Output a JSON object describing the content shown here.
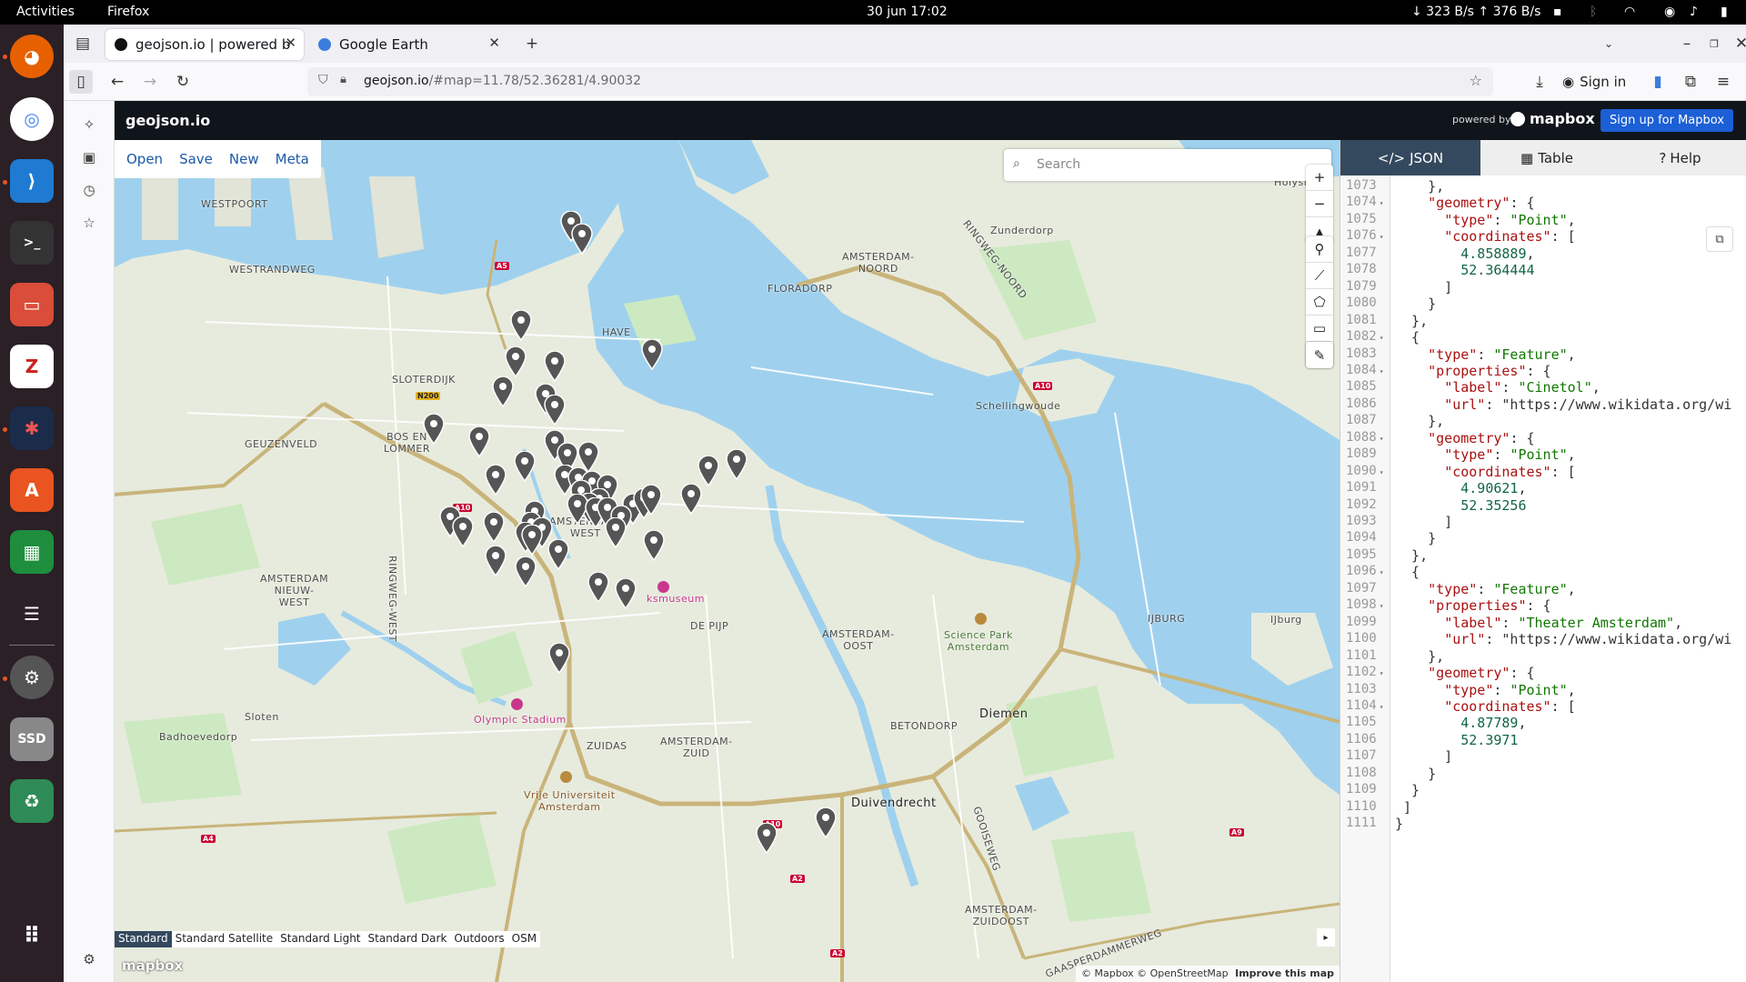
{
  "system": {
    "activities": "Activities",
    "app_name": "Firefox",
    "datetime": "30 jun  17:02",
    "network": "↓ 323 B/s ↑ 376 B/s"
  },
  "dock": {
    "items": [
      "firefox-icon",
      "chrome-icon",
      "vscode-icon",
      "terminal-icon",
      "files-icon",
      "zotero-icon",
      "davinci-icon",
      "software-icon",
      "spreadsheet-icon",
      "dataset-icon",
      "settings-icon",
      "ssd-icon",
      "trash-icon",
      "apps-grid-icon"
    ],
    "ssd_label": "SSD"
  },
  "browser": {
    "tabs": [
      {
        "title": "geojson.io | powered by M",
        "active": true
      },
      {
        "title": "Google Earth",
        "active": false
      }
    ],
    "url_host": "geojson.io",
    "url_path": "/#map=11.78/52.36281/4.90032",
    "sign_in": "Sign in"
  },
  "geojson": {
    "logo": "geojson.io",
    "powered_by": "powered by",
    "mapbox": "mapbox",
    "signup": "Sign up for Mapbox",
    "menu": [
      "Open",
      "Save",
      "New",
      "Meta"
    ],
    "search_placeholder": "Search",
    "panel_tabs": [
      "JSON",
      "Table",
      "Help"
    ],
    "map_styles": [
      "Standard",
      "Standard Satellite",
      "Standard Light",
      "Standard Dark",
      "Outdoors",
      "OSM"
    ],
    "selected_style": "Standard",
    "attribution": "© Mapbox © OpenStreetMap",
    "improve": "Improve this map",
    "mapbox_logo": "mapbox"
  },
  "map_labels": {
    "westpoort": "WESTPOORT",
    "westrandweg": "WESTRANDWEG",
    "sloterdijk": "SLOTERDIJK",
    "geuzenveld": "GEUZENVELD",
    "bos_en_lommer": "BOS EN\nLOMMER",
    "amsterdam_noord": "AMSTERDAM-\nNOORD",
    "zunderdorp": "Zunderdorp",
    "floradorp": "FLORADORP",
    "schellingwoude": "Schellingwoude",
    "ringweg_noord": "RINGWEG-NOORD",
    "amsterdam_nieuw_west": "AMSTERDAM\nNIEUW-\nWEST",
    "ringweg_west": "RINGWEG-WEST",
    "amsterdam_west": "AMSTERDAM-\nWEST",
    "amsterdam_oost": "AMSTERDAM-\nOOST",
    "science_park": "Science Park\nAmsterdam",
    "ijburg_caps": "IJBURG",
    "ijburg": "IJburg",
    "rijksmuseum": "ksmuseum",
    "de_pijp": "DE PIJP",
    "olympic_stadium": "Olympic Stadium",
    "sloten": "Sloten",
    "badhoevedorp": "Badhoevedorp",
    "zuidas": "ZUIDAS",
    "amsterdam_zuid": "AMSTERDAM-\nZUID",
    "vrije_universiteit": "Vrije Universiteit\nAmsterdam",
    "betondorp": "BETONDORP",
    "diemen": "Diemen",
    "duivendrecht": "Duivendrecht",
    "gooiseweg": "GOOISEWEG",
    "amsterdam_zuidoost": "AMSTERDAM-\nZUIDOOST",
    "gaasperdammerweg": "GAASPERDAMMERWEG",
    "holysloot": "Holysloot",
    "havens": "HAVE",
    "shields": [
      "A5",
      "N200",
      "A10",
      "A10",
      "A10",
      "A10",
      "A4",
      "A2",
      "A2",
      "A9"
    ]
  },
  "editor": {
    "lines": [
      {
        "n": "1073",
        "text": "    },",
        "fold": false
      },
      {
        "n": "1074",
        "text": "    \"geometry\": {",
        "fold": true
      },
      {
        "n": "1075",
        "text": "      \"type\": \"Point\",",
        "fold": false
      },
      {
        "n": "1076",
        "text": "      \"coordinates\": [",
        "fold": true
      },
      {
        "n": "1077",
        "text": "        4.858889,",
        "fold": false
      },
      {
        "n": "1078",
        "text": "        52.364444",
        "fold": false
      },
      {
        "n": "1079",
        "text": "      ]",
        "fold": false
      },
      {
        "n": "1080",
        "text": "    }",
        "fold": false
      },
      {
        "n": "1081",
        "text": "  },",
        "fold": false
      },
      {
        "n": "1082",
        "text": "  {",
        "fold": true
      },
      {
        "n": "1083",
        "text": "    \"type\": \"Feature\",",
        "fold": false
      },
      {
        "n": "1084",
        "text": "    \"properties\": {",
        "fold": true
      },
      {
        "n": "1085",
        "text": "      \"label\": \"Cinetol\",",
        "fold": false
      },
      {
        "n": "1086",
        "text": "      \"url\": \"https://www.wikidata.org/wi",
        "fold": false
      },
      {
        "n": "1087",
        "text": "    },",
        "fold": false
      },
      {
        "n": "1088",
        "text": "    \"geometry\": {",
        "fold": true
      },
      {
        "n": "1089",
        "text": "      \"type\": \"Point\",",
        "fold": false
      },
      {
        "n": "1090",
        "text": "      \"coordinates\": [",
        "fold": true
      },
      {
        "n": "1091",
        "text": "        4.90621,",
        "fold": false
      },
      {
        "n": "1092",
        "text": "        52.35256",
        "fold": false
      },
      {
        "n": "1093",
        "text": "      ]",
        "fold": false
      },
      {
        "n": "1094",
        "text": "    }",
        "fold": false
      },
      {
        "n": "1095",
        "text": "  },",
        "fold": false
      },
      {
        "n": "1096",
        "text": "  {",
        "fold": true
      },
      {
        "n": "1097",
        "text": "    \"type\": \"Feature\",",
        "fold": false
      },
      {
        "n": "1098",
        "text": "    \"properties\": {",
        "fold": true
      },
      {
        "n": "1099",
        "text": "      \"label\": \"Theater Amsterdam\",",
        "fold": false
      },
      {
        "n": "1100",
        "text": "      \"url\": \"https://www.wikidata.org/wi",
        "fold": false
      },
      {
        "n": "1101",
        "text": "    },",
        "fold": false
      },
      {
        "n": "1102",
        "text": "    \"geometry\": {",
        "fold": true
      },
      {
        "n": "1103",
        "text": "      \"type\": \"Point\",",
        "fold": false
      },
      {
        "n": "1104",
        "text": "      \"coordinates\": [",
        "fold": true
      },
      {
        "n": "1105",
        "text": "        4.87789,",
        "fold": false
      },
      {
        "n": "1106",
        "text": "        52.3971",
        "fold": false
      },
      {
        "n": "1107",
        "text": "      ]",
        "fold": false
      },
      {
        "n": "1108",
        "text": "    }",
        "fold": false
      },
      {
        "n": "1109",
        "text": "  }",
        "fold": false
      },
      {
        "n": "1110",
        "text": " ]",
        "fold": false
      },
      {
        "n": "1111",
        "text": "}",
        "fold": false
      }
    ]
  },
  "colors": {
    "header": "#10151c",
    "accent": "#1c5fd6",
    "selected_tab": "#34495e",
    "water": "#9fd1ee",
    "park": "#cde9c1",
    "pin": "#555555"
  }
}
